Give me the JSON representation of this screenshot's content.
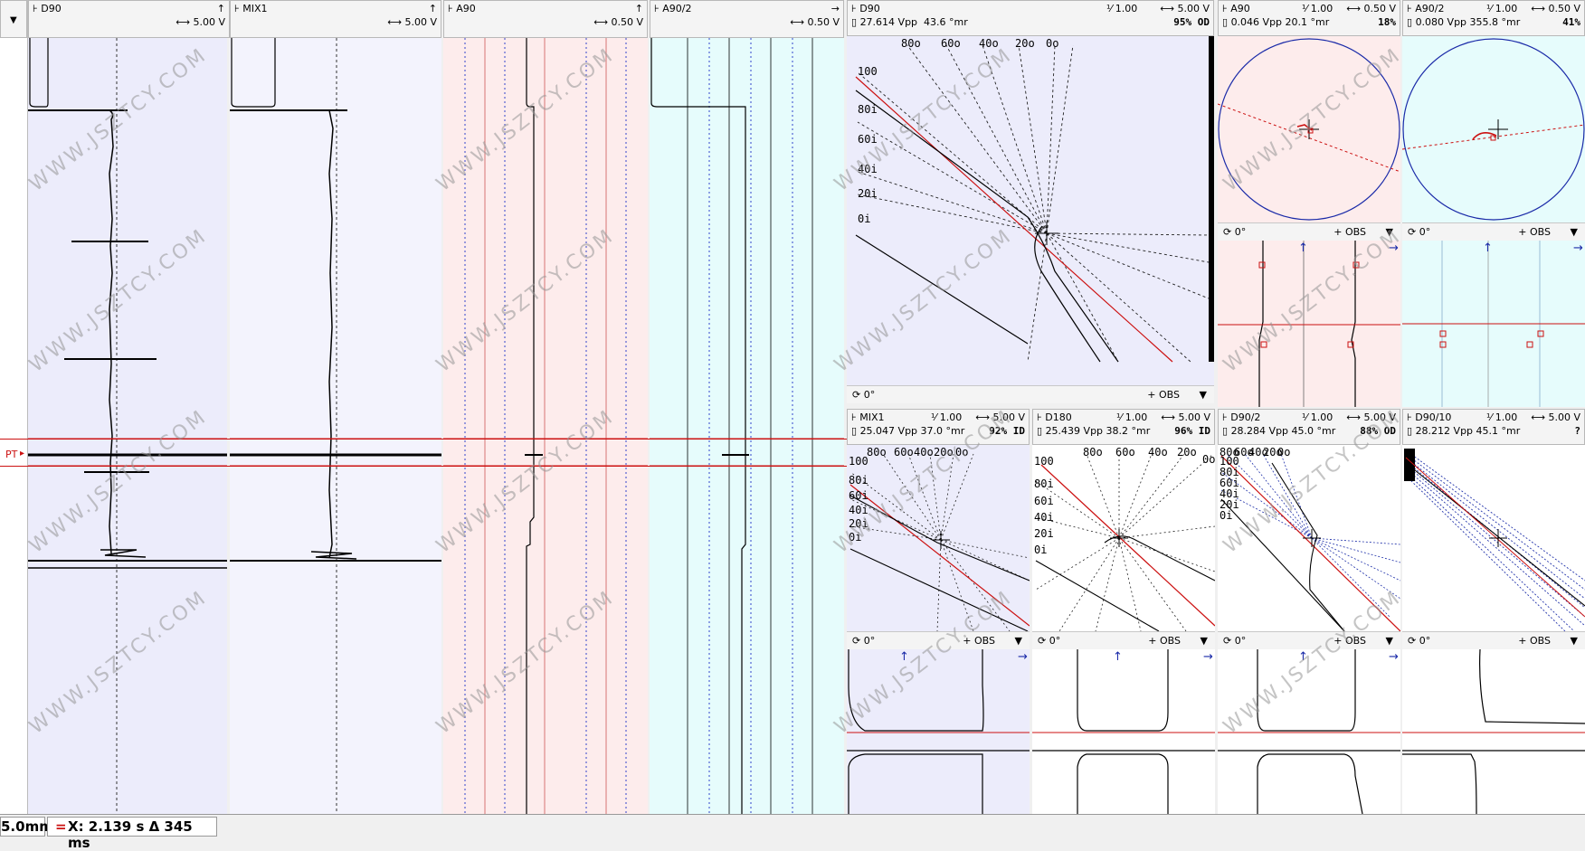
{
  "strips": [
    {
      "name": "D90",
      "scale": "5.00 V",
      "arrow": "↑"
    },
    {
      "name": "MIX1",
      "scale": "5.00 V",
      "arrow": "↑"
    },
    {
      "name": "A90",
      "scale": "0.50 V",
      "arrow": "↑"
    },
    {
      "name": "A90/2",
      "scale": "0.50 V",
      "arrow": "→"
    }
  ],
  "marker_label": "PT",
  "lissajous_top": [
    {
      "name": "D90",
      "ratio": "1.00",
      "scale": "5.00 V",
      "vpp": "27.614 Vpp",
      "angle": "43.6 °mr",
      "percent": "95% OD",
      "rot": "0°",
      "obs": "OBS"
    },
    {
      "name": "A90",
      "ratio": "1.00",
      "scale": "0.50 V",
      "vpp": "0.046 Vpp",
      "angle": "20.1 °mr",
      "percent": "18%",
      "rot": "0°",
      "obs": "OBS"
    },
    {
      "name": "A90/2",
      "ratio": "1.00",
      "scale": "0.50 V",
      "vpp": "0.080 Vpp",
      "angle": "355.8 °mr",
      "percent": "41%",
      "rot": "0°",
      "obs": "OBS"
    }
  ],
  "lissajous_bottom": [
    {
      "name": "MIX1",
      "ratio": "1.00",
      "scale": "5.00 V",
      "vpp": "25.047 Vpp",
      "angle": "37.0 °mr",
      "percent": "92% ID",
      "rot": "0°",
      "obs": "OBS"
    },
    {
      "name": "D180",
      "ratio": "1.00",
      "scale": "5.00 V",
      "vpp": "25.439 Vpp",
      "angle": "38.2 °mr",
      "percent": "96% ID",
      "rot": "0°",
      "obs": "OBS"
    },
    {
      "name": "D90/2",
      "ratio": "1.00",
      "scale": "5.00 V",
      "vpp": "28.284 Vpp",
      "angle": "45.0 °mr",
      "percent": "88% OD",
      "rot": "0°",
      "obs": "OBS"
    },
    {
      "name": "D90/10",
      "ratio": "1.00",
      "scale": "5.00 V",
      "vpp": "28.212 Vpp",
      "angle": "45.1 °mr",
      "percent": "?",
      "rot": "0°",
      "obs": "OBS"
    }
  ],
  "d90_plot_labels": {
    "top": [
      "80o",
      "60o",
      "40o",
      "20o",
      "0o"
    ],
    "left": [
      "100",
      "80i",
      "60i",
      "40i",
      "20i",
      "0i"
    ]
  },
  "mix1_plot_labels": {
    "top": [
      "80o",
      "60o",
      "40o",
      "20o",
      "0o"
    ],
    "left": [
      "100",
      "80i",
      "60i",
      "40i",
      "20i",
      "0i"
    ]
  },
  "d180_plot_labels": {
    "top": [
      "80o",
      "60o",
      "40o",
      "20o",
      "0o"
    ],
    "left": [
      "100",
      "80i",
      "60i",
      "40i",
      "20i",
      "0i"
    ]
  },
  "d902_plot_labels": {
    "top": [
      "80o",
      "60o",
      "40o",
      "20o",
      "0o"
    ],
    "left": [
      "100",
      "80i",
      "60i",
      "40i",
      "20i",
      "0i"
    ]
  },
  "status": {
    "left": "5.0mm",
    "cursor": "X: 2.139 s Δ 345 ms"
  },
  "watermark": "WWW.JSZTCY.COM",
  "colors": {
    "blue_bg": "#ececfb",
    "pink_bg": "#fdecec",
    "cyan_bg": "#e6fcfc",
    "white": "#ffffff",
    "red": "#cc1111",
    "blue": "#1a2aa8"
  }
}
